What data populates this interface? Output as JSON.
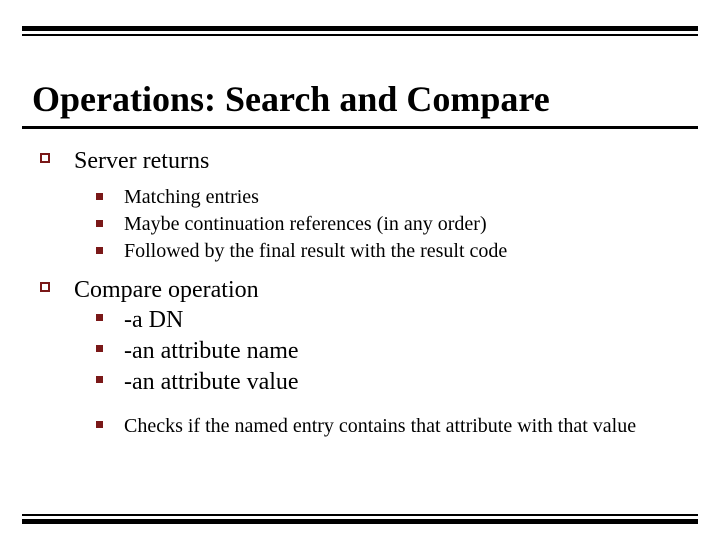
{
  "title": "Operations: Search and Compare",
  "items": [
    {
      "label": "Server returns",
      "sub": [
        "Matching entries",
        "Maybe continuation references (in any order)",
        "Followed by the final result with the result code"
      ]
    },
    {
      "label": "Compare operation",
      "subBig": [
        "-a DN",
        "-an attribute name",
        "-an attribute value"
      ],
      "subNote": "Checks if the named entry contains that attribute with that value"
    }
  ]
}
